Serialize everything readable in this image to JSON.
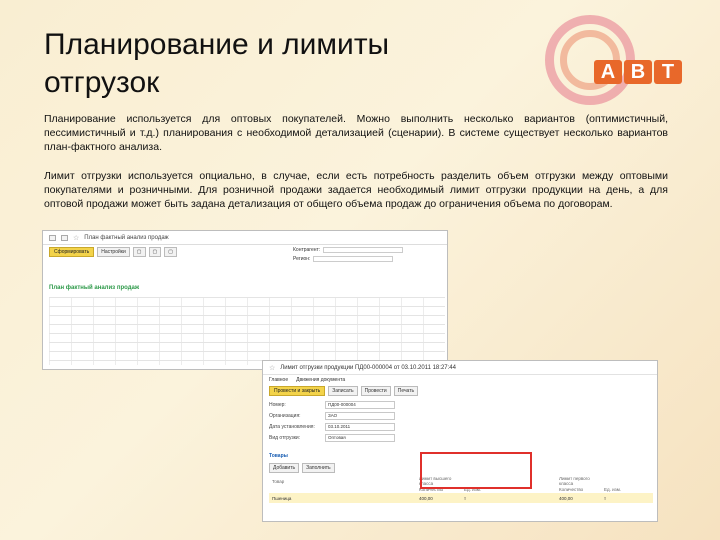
{
  "slide": {
    "title": "Планирование и лимиты отгрузок",
    "paragraph1": "Планирование используется для оптовых покупателей. Можно выполнить несколько вариантов (оптимистичный, пессимистичный и т.д.) планирования с необходимой детализацией (сценарии). В системе существует несколько вариантов план-фактного анализа.",
    "paragraph2": "Лимит отгрузки используется опциально, в случае, если есть потребность разделить объем отгрузки между оптовыми покупателями и розничными. Для розничной продажи задается необходимый лимит отгрузки продукции на день, а для оптовой продажи может быть задана детализация от общего объема продаж до ограничения объема по договорам."
  },
  "logo": {
    "letters": [
      "А",
      "В",
      "Т"
    ],
    "color": "#e8682a"
  },
  "screenshot1": {
    "window_title": "План фактный анализ продаж",
    "report_title": "План фактный анализ продаж",
    "buttons": [
      "Сформировать",
      "Настройки",
      "",
      "",
      ""
    ],
    "fields": [
      "Контрагент:",
      "Регион:"
    ]
  },
  "screenshot2": {
    "window_title": "Лимит отгрузки продукции ПД00-000004 от 03.10.2011 18:27:44",
    "links": [
      "Главное",
      "Движения документа"
    ],
    "toolbar": [
      "Провести и закрыть",
      "Записать",
      "Провести",
      "Печать"
    ],
    "form": [
      {
        "label": "Номер:",
        "value": "ПД00-000004"
      },
      {
        "label": "Организация:",
        "value": "ЗАО"
      },
      {
        "label": "Дата установления:",
        "value": "03.10.2011"
      },
      {
        "label": "Вид отгрузки:",
        "value": "Оптовая"
      }
    ],
    "tabs": [
      "Товары"
    ],
    "toolbar2": [
      "Добавить",
      "Заполнить"
    ],
    "table": {
      "col_headers": [
        "Товар",
        "Лимит высшего класса",
        "",
        "Лимит первого класса",
        ""
      ],
      "sub_headers": [
        "",
        "Количество",
        "Ед. изм.",
        "Количество",
        "Ед. изм."
      ],
      "rows": [
        [
          "Пшеница",
          "400,00",
          "т",
          "400,00",
          "т"
        ]
      ]
    },
    "highlight_color": "#e0302b"
  }
}
